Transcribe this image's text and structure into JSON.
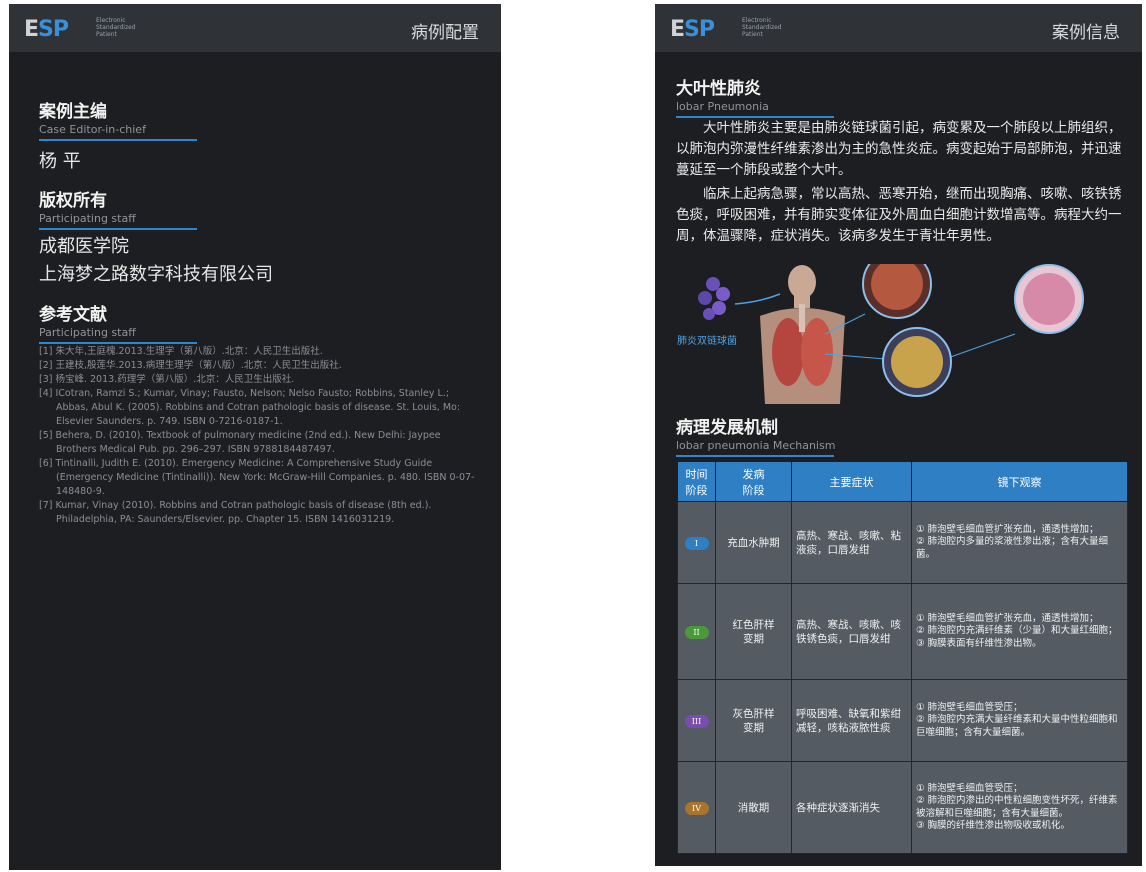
{
  "left": {
    "logo": {
      "mark": "ESP",
      "sub": [
        "Electronic",
        "Standardized",
        "Patient"
      ]
    },
    "title": "病例配置",
    "editor": {
      "title": "案例主编",
      "sub": "Case  Editor-in-chief",
      "name": "杨 平"
    },
    "copyright": {
      "title": "版权所有",
      "sub": "Participating staff",
      "lines": [
        "成都医学院",
        "上海梦之路数字科技有限公司"
      ]
    },
    "references": {
      "title": "参考文献",
      "sub": "Participating staff",
      "items": [
        "[1] 朱大年,王庭槐.2013.生理学（第八版）.北京：人民卫生出版社.",
        "[2] 王建枝,殷莲华.2013.病理生理学（第八版）.北京：人民卫生出版社.",
        "[3]  杨宝峰. 2013.药理学（第八版）.北京：人民卫生出版社.",
        "[4]  ICotran, Ramzi S.; Kumar, Vinay; Fausto, Nelson; Nelso Fausto; Robbins, Stanley L.; Abbas, Abul K. (2005). Robbins and Cotran pathologic basis of disease. St. Louis, Mo: Elsevier Saunders. p. 749. ISBN 0-7216-0187-1.",
        "[5]  Behera, D. (2010). Textbook of pulmonary medicine (2nd ed.). New Delhi: Jaypee Brothers Medical Pub. pp. 296–297. ISBN 9788184487497.",
        "[6]  Tintinalli, Judith E. (2010). Emergency Medicine: A Comprehensive Study Guide (Emergency Medicine (Tintinalli)). New York: McGraw-Hill Companies. p. 480. ISBN 0-07-148480-9.",
        "[7]  Kumar, Vinay (2010). Robbins and Cotran pathologic basis of disease (8th ed.). Philadelphia, PA: Saunders/Elsevier. pp. Chapter 15. ISBN 1416031219."
      ]
    }
  },
  "right": {
    "logo": {
      "mark": "ESP",
      "sub": [
        "Electronic",
        "Standardized",
        "Patient"
      ]
    },
    "title": "案例信息",
    "disease": {
      "title": "大叶性肺炎",
      "sub": "lobar Pneumonia"
    },
    "para1": "大叶性肺炎主要是由肺炎链球菌引起，病变累及一个肺段以上肺组织，以肺泡内弥漫性纤维素渗出为主的急性炎症。病变起始于局部肺泡，并迅速蔓延至一个肺段或整个大叶。",
    "para2": "临床上起病急骤，常以高热、恶寒开始，继而出现胸痛、咳嗽、咳铁锈色痰，呼吸困难，并有肺实变体征及外周血白细胞计数增高等。病程大约一周，体温骤降，症状消失。该病多发生于青壮年男性。",
    "illustration_label": "肺炎双链球菌",
    "mechanism": {
      "title": "病理发展机制",
      "sub": "lobar pneumonia Mechanism"
    },
    "table": {
      "headers": [
        "时间\n阶段",
        "发病\n阶段",
        "主要症状",
        "镜下观察"
      ],
      "rows": [
        {
          "badge": "I",
          "badge_color": "#2f7fc4",
          "phase": "充血水肿期",
          "symptoms": "高热、寒战、咳嗽、粘液痰，口唇发绀",
          "obs": [
            "① 肺泡壁毛细血管扩张充血，通透性增加；",
            "② 肺泡腔内多量的浆液性渗出液；含有大量细菌。"
          ]
        },
        {
          "badge": "II",
          "badge_color": "#4a9a3a",
          "phase": "红色肝样\n变期",
          "symptoms": "高热、寒战、咳嗽、咳铁锈色痰，口唇发绀",
          "obs": [
            "① 肺泡壁毛细血管扩张充血，通透性增加；",
            "② 肺泡腔内充满纤维素（少量）和大量红细胞；",
            "③ 胸膜表面有纤维性渗出物。"
          ]
        },
        {
          "badge": "III",
          "badge_color": "#7a4cb0",
          "phase": "灰色肝样\n变期",
          "symptoms": "呼吸困难、缺氧和紫绀减轻，咳粘液脓性痰",
          "obs": [
            "① 肺泡壁毛细血管受压；",
            "② 肺泡腔内充满大量纤维素和大量中性粒细胞和巨噬细胞；含有大量细菌。"
          ]
        },
        {
          "badge": "IV",
          "badge_color": "#a8742e",
          "phase": "消散期",
          "symptoms": "各种症状逐渐消失",
          "obs": [
            "① 肺泡壁毛细血管受压；",
            "② 肺泡腔内渗出的中性粒细胞变性坏死，纤维素被溶解和巨噬细胞；含有大量细菌。",
            "③ 胸膜的纤维性渗出物吸收或机化。"
          ]
        }
      ]
    }
  }
}
